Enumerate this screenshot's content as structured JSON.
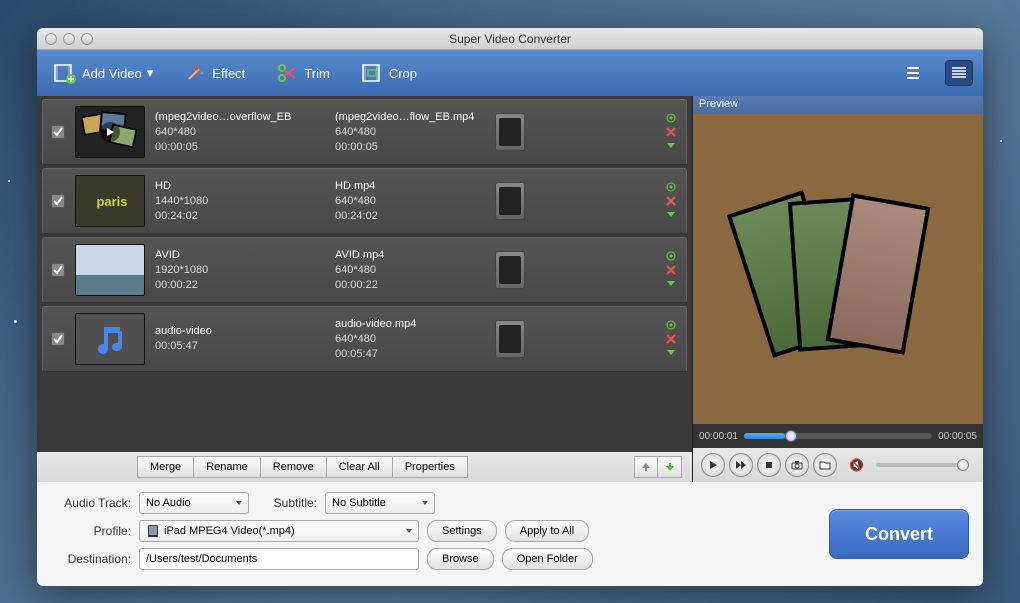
{
  "window": {
    "title": "Super Video Converter"
  },
  "toolbar": {
    "add_video": "Add Video",
    "effect": "Effect",
    "trim": "Trim",
    "crop": "Crop"
  },
  "rows": [
    {
      "src_name": "(mpeg2video…overflow_EB",
      "src_res": "640*480",
      "src_dur": "00:00:05",
      "out_name": "(mpeg2video…flow_EB.mp4",
      "out_res": "640*480",
      "out_dur": "00:00:05"
    },
    {
      "src_name": "HD",
      "src_res": "1440*1080",
      "src_dur": "00:24:02",
      "out_name": "HD.mp4",
      "out_res": "640*480",
      "out_dur": "00:24:02"
    },
    {
      "src_name": "AVID",
      "src_res": "1920*1080",
      "src_dur": "00:00:22",
      "out_name": "AVID.mp4",
      "out_res": "640*480",
      "out_dur": "00:00:22"
    },
    {
      "src_name": "audio-video",
      "src_res": "",
      "src_dur": "00:05:47",
      "out_name": "audio-video.mp4",
      "out_res": "640*480",
      "out_dur": "00:05:47"
    }
  ],
  "actions": {
    "merge": "Merge",
    "rename": "Rename",
    "remove": "Remove",
    "clear_all": "Clear All",
    "properties": "Properties"
  },
  "preview": {
    "label": "Preview",
    "time_current": "00:00:01",
    "time_total": "00:00:05"
  },
  "form": {
    "audio_track_label": "Audio Track:",
    "audio_track_value": "No Audio",
    "subtitle_label": "Subtitle:",
    "subtitle_value": "No Subtitle",
    "profile_label": "Profile:",
    "profile_value": "iPad MPEG4 Video(*.mp4)",
    "destination_label": "Destination:",
    "destination_value": "/Users/test/Documents",
    "settings": "Settings",
    "apply_all": "Apply to All",
    "browse": "Browse",
    "open_folder": "Open Folder",
    "convert": "Convert"
  }
}
